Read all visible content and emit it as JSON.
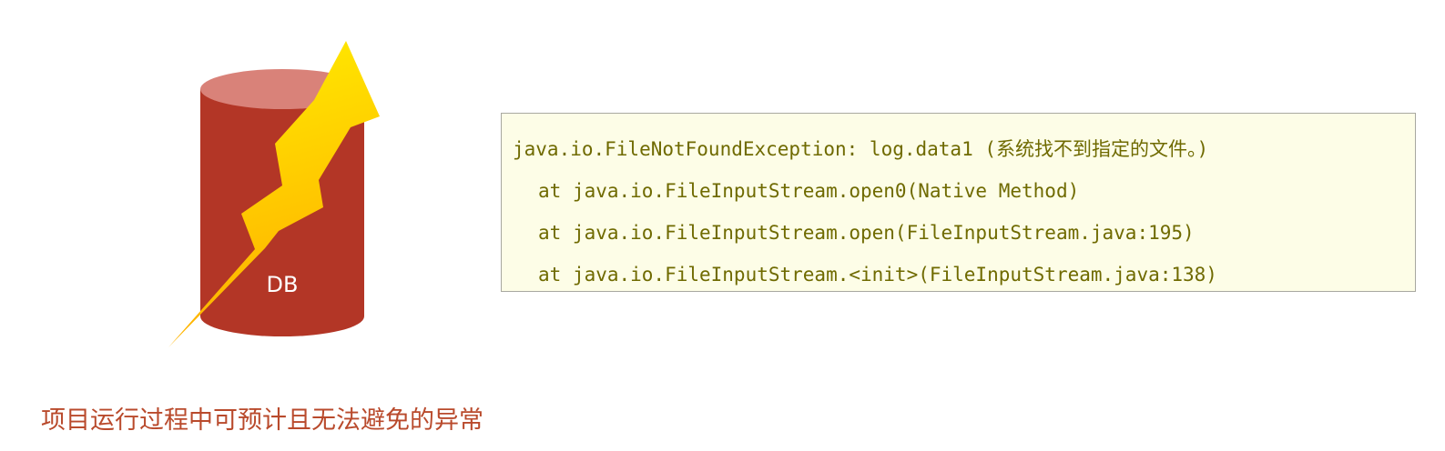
{
  "figure": {
    "db_label": "DB",
    "icons": [
      "database-cylinder-icon",
      "lightning-bolt-icon"
    ],
    "colors": {
      "cylinder_body": "#b33626",
      "cylinder_top": "#d98279",
      "bolt_light": "#ffee00",
      "bolt_dark": "#ffb000"
    }
  },
  "exception": {
    "lines": [
      "java.io.FileNotFoundException: log.data1 (系统找不到指定的文件。)",
      "at java.io.FileInputStream.open0(Native Method)",
      "at java.io.FileInputStream.open(FileInputStream.java:195)",
      "at java.io.FileInputStream.<init>(FileInputStream.java:138)"
    ],
    "text_color": "#6f6a00",
    "background": "#fdfde7"
  },
  "caption": {
    "text": "项目运行过程中可预计且无法避免的异常",
    "color": "#b94a2c"
  }
}
